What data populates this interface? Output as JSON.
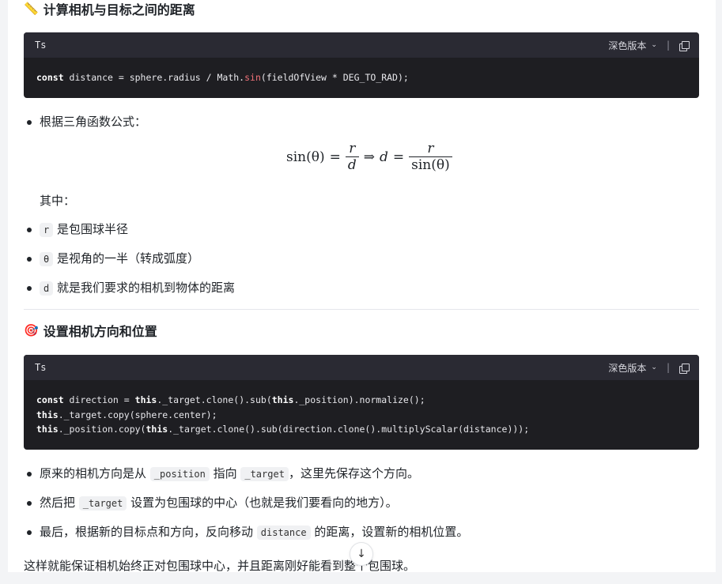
{
  "section1": {
    "emoji": "📏",
    "title": "计算相机与目标之间的距离",
    "code": {
      "lang": "Ts",
      "theme_label": "深色版本",
      "separator": "|",
      "line1_kw": "const",
      "line1_rest_a": " distance = sphere.radius / Math.",
      "line1_fn": "sin",
      "line1_rest_b": "(fieldOfView * DEG_TO_RAD);"
    },
    "bullet_intro": "根据三角函数公式：",
    "formula": {
      "lhs": "sin(θ)",
      "eq": "=",
      "frac1_num": "r",
      "frac1_den": "d",
      "implies": "⇒",
      "d": "d",
      "eq2": "=",
      "frac2_num": "r",
      "frac2_den": "sin(θ)"
    },
    "note": "其中：",
    "items": [
      {
        "code": "r",
        "text": "是包围球半径"
      },
      {
        "code": "θ",
        "text": "是视角的一半（转成弧度）"
      },
      {
        "code": "d",
        "text": "就是我们要求的相机到物体的距离"
      }
    ]
  },
  "section2": {
    "emoji": "🎯",
    "title": "设置相机方向和位置",
    "code": {
      "lang": "Ts",
      "theme_label": "深色版本",
      "separator": "|",
      "l1_kw": "const",
      "l1_a": " direction = ",
      "l1_this1": "this",
      "l1_b": "._target.clone().sub(",
      "l1_this2": "this",
      "l1_c": "._position).normalize();",
      "l2_this": "this",
      "l2_a": "._target.copy(sphere.center);",
      "l3_this1": "this",
      "l3_a": "._position.copy(",
      "l3_this2": "this",
      "l3_b": "._target.clone().sub(direction.clone().multiplyScalar(distance)));"
    },
    "items": [
      {
        "pre": "原来的相机方向是从 ",
        "code1": "_position",
        "mid": " 指向 ",
        "code2": "_target",
        "post": "，这里先保存这个方向。"
      },
      {
        "pre": "然后把 ",
        "code1": "_target",
        "post": " 设置为包围球的中心（也就是我们要看向的地方）。"
      },
      {
        "pre": "最后，根据新的目标点和方向，反向移动 ",
        "code1": "distance",
        "post": " 的距离，设置新的相机位置。"
      }
    ]
  },
  "footer": {
    "text": "这样就能保证相机始终正对包围球中心，并且距离刚好能看到整个包围球。"
  },
  "scroll_button": {
    "icon": "arrow-down-icon",
    "glyph": "↓"
  }
}
